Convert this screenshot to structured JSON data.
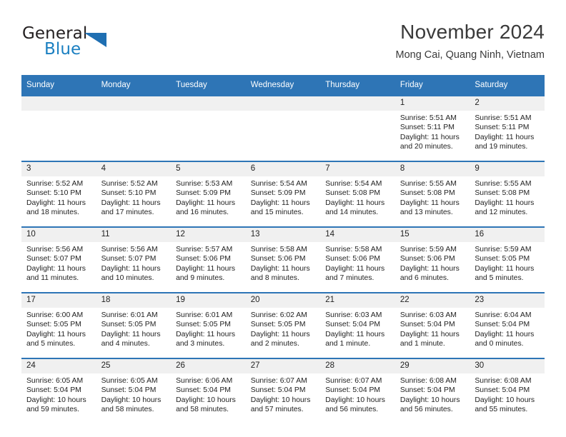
{
  "brand": {
    "name_part1": "General",
    "name_part2": "Blue",
    "triangle_color": "#1f6fb2",
    "text_color": "#231f20",
    "blue_text_color": "#1a7fc1"
  },
  "header": {
    "title": "November 2024",
    "subtitle": "Mong Cai, Quang Ninh, Vietnam"
  },
  "theme": {
    "header_blue": "#2e75b6",
    "date_band_gray": "#f0f0f0",
    "text": "#222222"
  },
  "calendar": {
    "weekday_headers": [
      "Sunday",
      "Monday",
      "Tuesday",
      "Wednesday",
      "Thursday",
      "Friday",
      "Saturday"
    ],
    "weeks": [
      [
        {
          "day": "",
          "sunrise": "",
          "sunset": "",
          "daylight": ""
        },
        {
          "day": "",
          "sunrise": "",
          "sunset": "",
          "daylight": ""
        },
        {
          "day": "",
          "sunrise": "",
          "sunset": "",
          "daylight": ""
        },
        {
          "day": "",
          "sunrise": "",
          "sunset": "",
          "daylight": ""
        },
        {
          "day": "",
          "sunrise": "",
          "sunset": "",
          "daylight": ""
        },
        {
          "day": "1",
          "sunrise": "Sunrise: 5:51 AM",
          "sunset": "Sunset: 5:11 PM",
          "daylight": "Daylight: 11 hours and 20 minutes."
        },
        {
          "day": "2",
          "sunrise": "Sunrise: 5:51 AM",
          "sunset": "Sunset: 5:11 PM",
          "daylight": "Daylight: 11 hours and 19 minutes."
        }
      ],
      [
        {
          "day": "3",
          "sunrise": "Sunrise: 5:52 AM",
          "sunset": "Sunset: 5:10 PM",
          "daylight": "Daylight: 11 hours and 18 minutes."
        },
        {
          "day": "4",
          "sunrise": "Sunrise: 5:52 AM",
          "sunset": "Sunset: 5:10 PM",
          "daylight": "Daylight: 11 hours and 17 minutes."
        },
        {
          "day": "5",
          "sunrise": "Sunrise: 5:53 AM",
          "sunset": "Sunset: 5:09 PM",
          "daylight": "Daylight: 11 hours and 16 minutes."
        },
        {
          "day": "6",
          "sunrise": "Sunrise: 5:54 AM",
          "sunset": "Sunset: 5:09 PM",
          "daylight": "Daylight: 11 hours and 15 minutes."
        },
        {
          "day": "7",
          "sunrise": "Sunrise: 5:54 AM",
          "sunset": "Sunset: 5:08 PM",
          "daylight": "Daylight: 11 hours and 14 minutes."
        },
        {
          "day": "8",
          "sunrise": "Sunrise: 5:55 AM",
          "sunset": "Sunset: 5:08 PM",
          "daylight": "Daylight: 11 hours and 13 minutes."
        },
        {
          "day": "9",
          "sunrise": "Sunrise: 5:55 AM",
          "sunset": "Sunset: 5:08 PM",
          "daylight": "Daylight: 11 hours and 12 minutes."
        }
      ],
      [
        {
          "day": "10",
          "sunrise": "Sunrise: 5:56 AM",
          "sunset": "Sunset: 5:07 PM",
          "daylight": "Daylight: 11 hours and 11 minutes."
        },
        {
          "day": "11",
          "sunrise": "Sunrise: 5:56 AM",
          "sunset": "Sunset: 5:07 PM",
          "daylight": "Daylight: 11 hours and 10 minutes."
        },
        {
          "day": "12",
          "sunrise": "Sunrise: 5:57 AM",
          "sunset": "Sunset: 5:06 PM",
          "daylight": "Daylight: 11 hours and 9 minutes."
        },
        {
          "day": "13",
          "sunrise": "Sunrise: 5:58 AM",
          "sunset": "Sunset: 5:06 PM",
          "daylight": "Daylight: 11 hours and 8 minutes."
        },
        {
          "day": "14",
          "sunrise": "Sunrise: 5:58 AM",
          "sunset": "Sunset: 5:06 PM",
          "daylight": "Daylight: 11 hours and 7 minutes."
        },
        {
          "day": "15",
          "sunrise": "Sunrise: 5:59 AM",
          "sunset": "Sunset: 5:06 PM",
          "daylight": "Daylight: 11 hours and 6 minutes."
        },
        {
          "day": "16",
          "sunrise": "Sunrise: 5:59 AM",
          "sunset": "Sunset: 5:05 PM",
          "daylight": "Daylight: 11 hours and 5 minutes."
        }
      ],
      [
        {
          "day": "17",
          "sunrise": "Sunrise: 6:00 AM",
          "sunset": "Sunset: 5:05 PM",
          "daylight": "Daylight: 11 hours and 5 minutes."
        },
        {
          "day": "18",
          "sunrise": "Sunrise: 6:01 AM",
          "sunset": "Sunset: 5:05 PM",
          "daylight": "Daylight: 11 hours and 4 minutes."
        },
        {
          "day": "19",
          "sunrise": "Sunrise: 6:01 AM",
          "sunset": "Sunset: 5:05 PM",
          "daylight": "Daylight: 11 hours and 3 minutes."
        },
        {
          "day": "20",
          "sunrise": "Sunrise: 6:02 AM",
          "sunset": "Sunset: 5:05 PM",
          "daylight": "Daylight: 11 hours and 2 minutes."
        },
        {
          "day": "21",
          "sunrise": "Sunrise: 6:03 AM",
          "sunset": "Sunset: 5:04 PM",
          "daylight": "Daylight: 11 hours and 1 minute."
        },
        {
          "day": "22",
          "sunrise": "Sunrise: 6:03 AM",
          "sunset": "Sunset: 5:04 PM",
          "daylight": "Daylight: 11 hours and 1 minute."
        },
        {
          "day": "23",
          "sunrise": "Sunrise: 6:04 AM",
          "sunset": "Sunset: 5:04 PM",
          "daylight": "Daylight: 11 hours and 0 minutes."
        }
      ],
      [
        {
          "day": "24",
          "sunrise": "Sunrise: 6:05 AM",
          "sunset": "Sunset: 5:04 PM",
          "daylight": "Daylight: 10 hours and 59 minutes."
        },
        {
          "day": "25",
          "sunrise": "Sunrise: 6:05 AM",
          "sunset": "Sunset: 5:04 PM",
          "daylight": "Daylight: 10 hours and 58 minutes."
        },
        {
          "day": "26",
          "sunrise": "Sunrise: 6:06 AM",
          "sunset": "Sunset: 5:04 PM",
          "daylight": "Daylight: 10 hours and 58 minutes."
        },
        {
          "day": "27",
          "sunrise": "Sunrise: 6:07 AM",
          "sunset": "Sunset: 5:04 PM",
          "daylight": "Daylight: 10 hours and 57 minutes."
        },
        {
          "day": "28",
          "sunrise": "Sunrise: 6:07 AM",
          "sunset": "Sunset: 5:04 PM",
          "daylight": "Daylight: 10 hours and 56 minutes."
        },
        {
          "day": "29",
          "sunrise": "Sunrise: 6:08 AM",
          "sunset": "Sunset: 5:04 PM",
          "daylight": "Daylight: 10 hours and 56 minutes."
        },
        {
          "day": "30",
          "sunrise": "Sunrise: 6:08 AM",
          "sunset": "Sunset: 5:04 PM",
          "daylight": "Daylight: 10 hours and 55 minutes."
        }
      ]
    ]
  }
}
